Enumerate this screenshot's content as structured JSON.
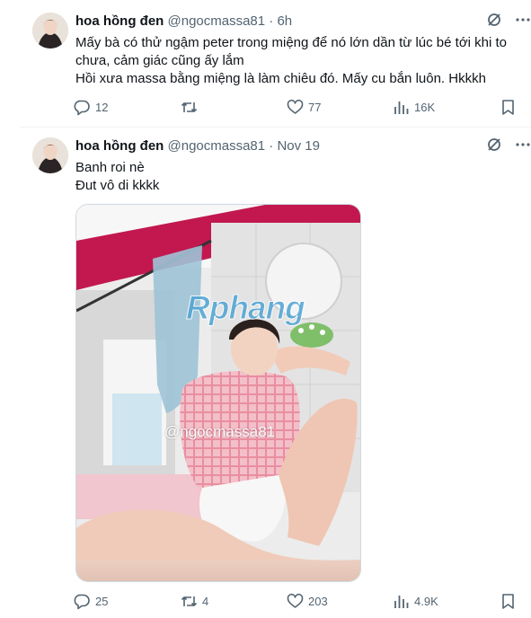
{
  "tweets": [
    {
      "author_name": "hoa hồng đen",
      "handle": "@ngocmassa81",
      "separator": "·",
      "time": "6h",
      "text_lines": [
        "Mấy bà có thử ngậm peter trong miệng để nó lớn dần từ lúc bé tới khi to",
        "chưa, cảm giác cũng ấy lắm",
        "Hồi xưa massa bằng miệng là làm chiêu đó. Mấy cu bắn luôn. Hkkkh"
      ],
      "stats": {
        "replies": "12",
        "retweets": "",
        "likes": "77",
        "views": "16K"
      }
    },
    {
      "author_name": "hoa hồng đen",
      "handle": "@ngocmassa81",
      "separator": "·",
      "time": "Nov 19",
      "text_lines": [
        "Banh roi nè",
        "Đut vô di kkkk"
      ],
      "media": {
        "watermark": "Rphang",
        "handle_overlay": "@ngocmassa81"
      },
      "stats": {
        "replies": "25",
        "retweets": "4",
        "likes": "203",
        "views": "4.9K"
      }
    }
  ],
  "icons": [
    "grok-icon",
    "more-icon",
    "reply-icon",
    "retweet-icon",
    "like-icon",
    "views-icon",
    "bookmark-icon"
  ],
  "colors": {
    "text": "#0f1419",
    "muted": "#536471",
    "divider": "#eff3f4"
  }
}
